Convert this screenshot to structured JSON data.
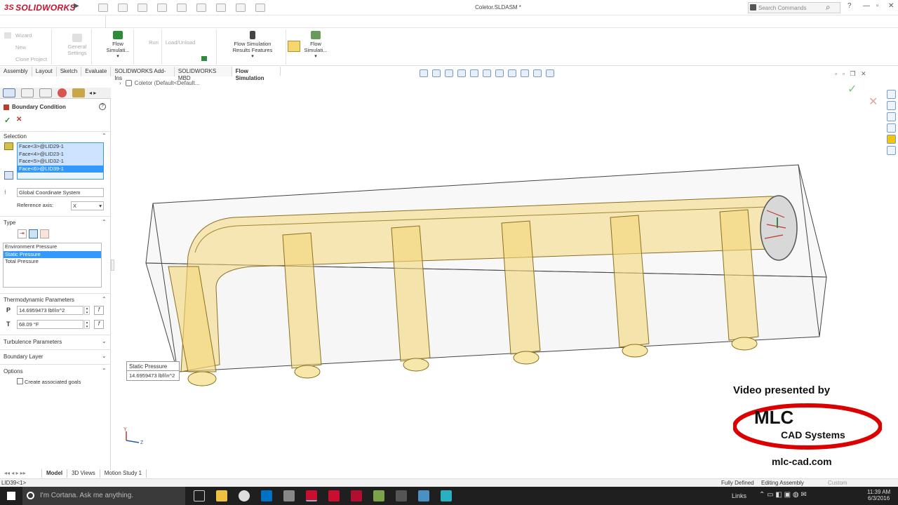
{
  "app": {
    "brand": "SOLIDWORKS",
    "document_title": "Coletor.SLDASM *",
    "search_placeholder": "Search Commands"
  },
  "window_controls": {
    "help": "?",
    "minimize": "—",
    "restore": "▫",
    "close": "✕"
  },
  "cmd_manager": {
    "wizard": "Wizard",
    "new": "New",
    "clone": "Clone Project",
    "general_settings": "General Settings",
    "flow_sim_1": "Flow Simulati...",
    "run": "Run",
    "load_unload": "Load/Unload",
    "results_features": "Flow Simulation Results Features",
    "flow_sim_2": "Flow Simulati..."
  },
  "tabs": [
    "Assembly",
    "Layout",
    "Sketch",
    "Evaluate",
    "SOLIDWORKS Add-Ins",
    "SOLIDWORKS MBD",
    "Flow Simulation"
  ],
  "active_tab": "Flow Simulation",
  "breadcrumb": "Coletor  (Default<Default...",
  "panel": {
    "title": "Boundary Condition",
    "ok": "✓",
    "cancel": "✕",
    "help": "?",
    "selection": {
      "header": "Selection",
      "faces": [
        "Face<3>@LID29-1",
        "Face<4>@LID23-1",
        "Face<5>@LID32-1",
        "Face<6>@LID39-1"
      ],
      "coord": "Global Coordinate System",
      "ref_axis_label": "Reference axis:",
      "ref_axis_value": "X"
    },
    "type": {
      "header": "Type",
      "options": [
        "Environment Pressure",
        "Static Pressure",
        "Total Pressure"
      ],
      "selected": "Static Pressure"
    },
    "thermo": {
      "header": "Thermodynamic Parameters",
      "p_label": "P",
      "p_value": "14.6959473 lbf/in^2",
      "t_label": "T",
      "t_value": "68.09 °F"
    },
    "turbulence": "Turbulence Parameters",
    "boundary_layer": "Boundary Layer",
    "options": {
      "header": "Options",
      "goal_label": "Create associated goals"
    }
  },
  "callout": {
    "title": "Static Pressure",
    "value": "14.6959473 lbf/in^2"
  },
  "bottom_tabs": [
    "Model",
    "3D Views",
    "Motion Study 1"
  ],
  "status": {
    "left": "LID39<1>",
    "fully_defined": "Fully Defined",
    "editing": "Editing Assembly",
    "custom": "Custom"
  },
  "taskbar": {
    "cortana": "I'm Cortana. Ask me anything.",
    "links": "Links",
    "time": "11:39 AM",
    "date": "6/3/2016"
  },
  "watermark": {
    "line1": "Video presented by",
    "mlc": "MLC",
    "cad": "CAD Systems",
    "url": "mlc-cad.com"
  },
  "colors": {
    "accent_red": "#c8102e",
    "selection_blue": "#3399ff",
    "model_yellow": "#f3d77a",
    "taskbar": "#1f1f1f"
  }
}
